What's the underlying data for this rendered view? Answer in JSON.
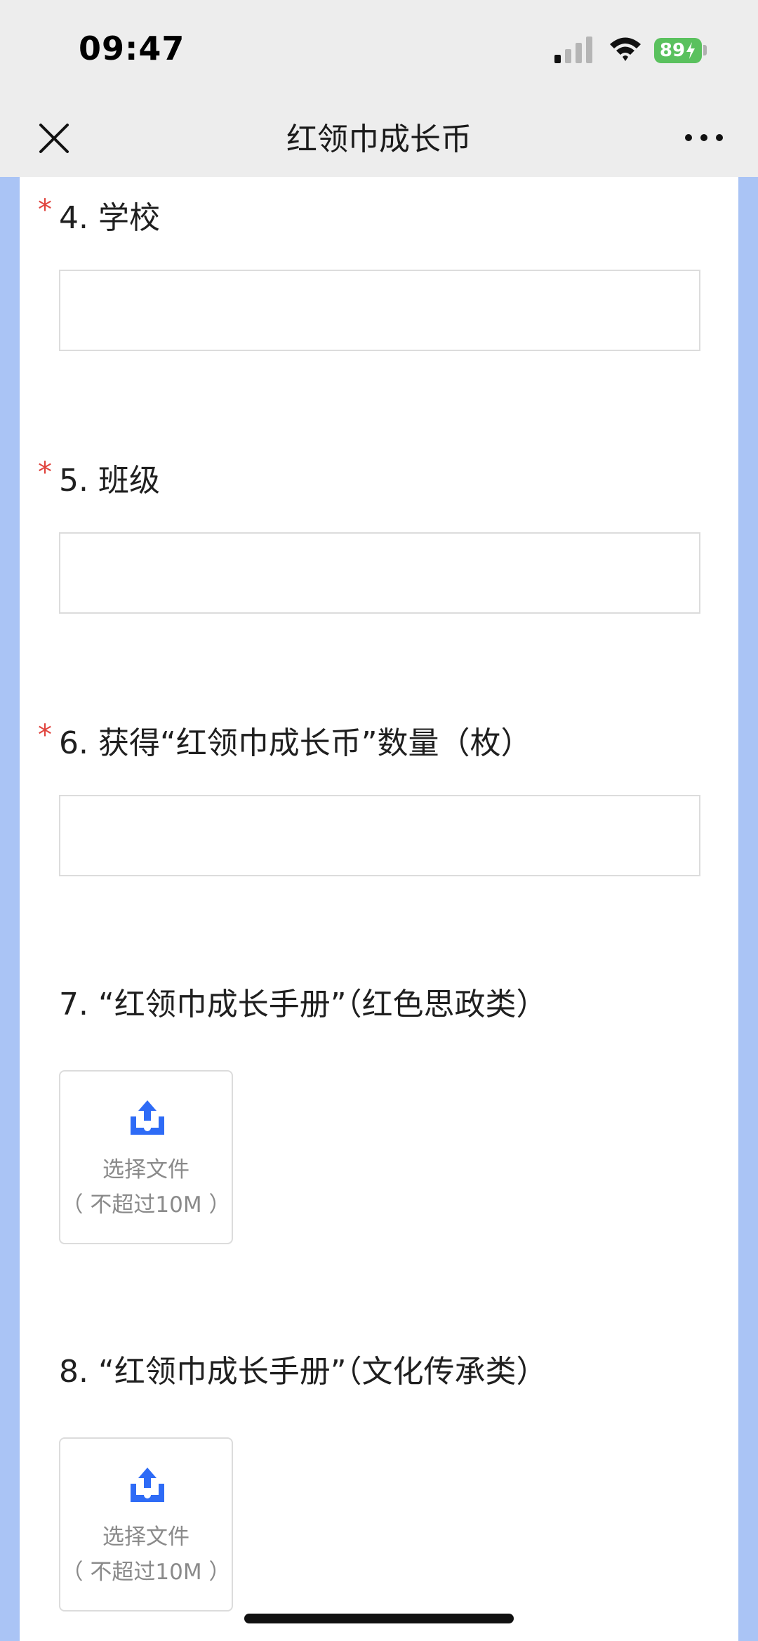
{
  "status_bar": {
    "time": "09:47",
    "battery": "89",
    "icons": [
      "signal-icon",
      "wifi-icon",
      "battery-icon"
    ]
  },
  "nav": {
    "title": "红领巾成长币",
    "icons": [
      "close-icon",
      "more-icon"
    ]
  },
  "colors": {
    "required": "#e0443e",
    "upload_icon": "#2e6bf6",
    "side_background": "#aac4f5",
    "battery": "#5ac15e"
  },
  "questions": [
    {
      "required_mark": "*",
      "label": "4. 学校",
      "type": "text",
      "value": ""
    },
    {
      "required_mark": "*",
      "label": "5. 班级",
      "type": "text",
      "value": ""
    },
    {
      "required_mark": "*",
      "label": "6. 获得“红领巾成长币”数量（枚）",
      "type": "text",
      "value": ""
    },
    {
      "label": "7. “红领巾成长手册”（红色思政类）",
      "type": "file",
      "upload_label": "选择文件",
      "upload_hint": "（ 不超过10M ）"
    },
    {
      "label": "8. “红领巾成长手册”（文化传承类）",
      "type": "file",
      "upload_label": "选择文件",
      "upload_hint": "（ 不超过10M ）"
    }
  ]
}
